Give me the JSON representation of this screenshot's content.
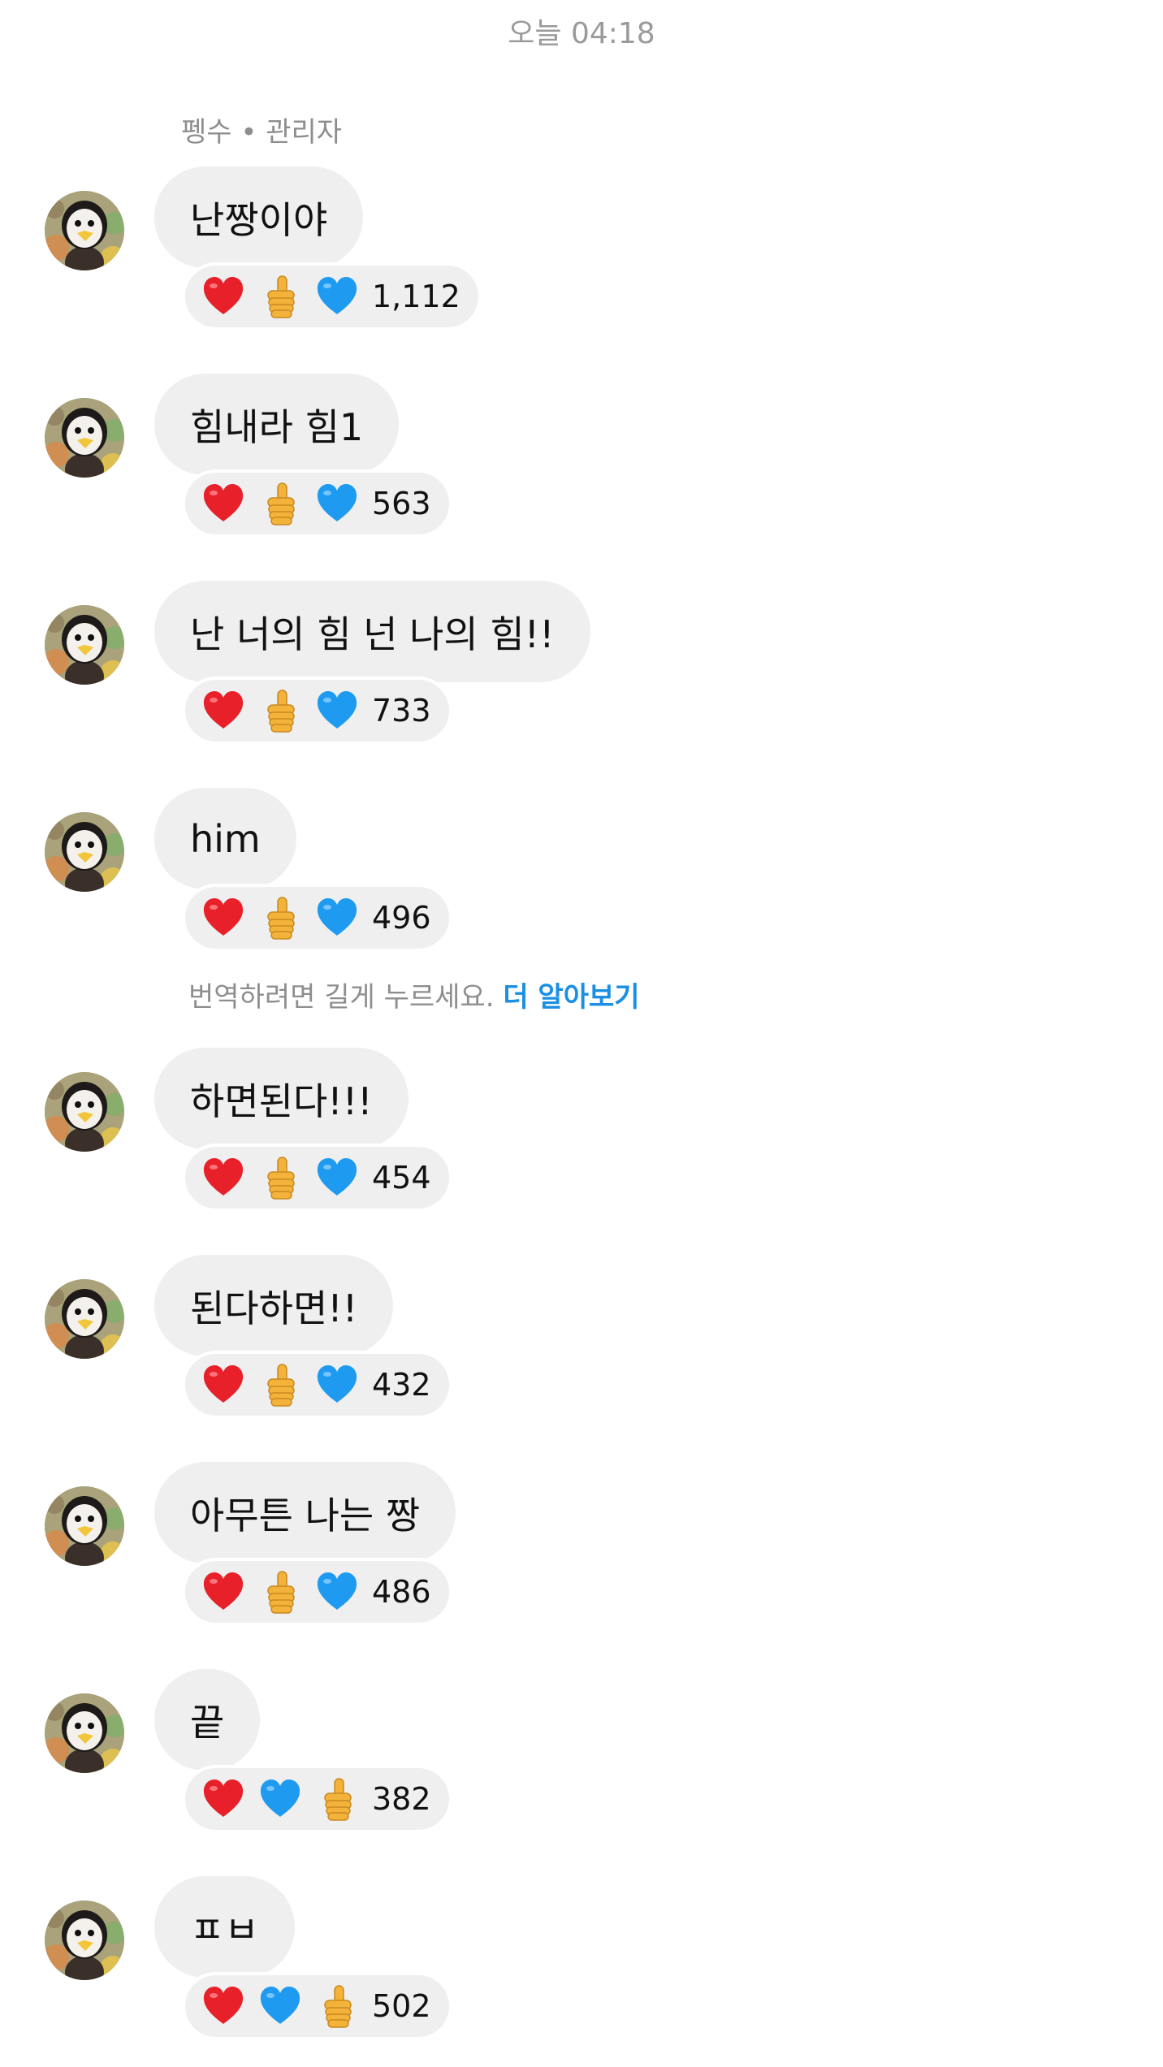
{
  "header": {
    "timestamp": "오늘 04:18"
  },
  "sender_line": "펭수 • 관리자",
  "messages": [
    {
      "text": "난짱이야",
      "reactions": [
        "heart-red",
        "thumbs-up",
        "heart-blue"
      ],
      "count": "1,112"
    },
    {
      "text": "힘내라 힘1",
      "reactions": [
        "heart-red",
        "thumbs-up",
        "heart-blue"
      ],
      "count": "563"
    },
    {
      "text": "난 너의 힘 넌 나의 힘!!",
      "reactions": [
        "heart-red",
        "thumbs-up",
        "heart-blue"
      ],
      "count": "733"
    },
    {
      "text": "him",
      "reactions": [
        "heart-red",
        "thumbs-up",
        "heart-blue"
      ],
      "count": "496"
    },
    {
      "text": "하면된다!!!",
      "reactions": [
        "heart-red",
        "thumbs-up",
        "heart-blue"
      ],
      "count": "454"
    },
    {
      "text": "된다하면!!",
      "reactions": [
        "heart-red",
        "thumbs-up",
        "heart-blue"
      ],
      "count": "432"
    },
    {
      "text": "아무튼 나는 짱",
      "reactions": [
        "heart-red",
        "thumbs-up",
        "heart-blue"
      ],
      "count": "486"
    },
    {
      "text": "끝",
      "reactions": [
        "heart-red",
        "heart-blue",
        "thumbs-up"
      ],
      "count": "382"
    },
    {
      "text": "ㅍㅂ",
      "reactions": [
        "heart-red",
        "heart-blue",
        "thumbs-up"
      ],
      "count": "502"
    }
  ],
  "translate_hint": {
    "text": "번역하려면 길게 누르세요. ",
    "link": "더 알아보기"
  },
  "colors": {
    "bubble": "#efefef",
    "link": "#1a8fe3",
    "muted_text": "#8e8e8e",
    "heart_red": "#e8202a",
    "heart_blue": "#1e9bf0",
    "thumbs_up": "#f3b23a"
  }
}
